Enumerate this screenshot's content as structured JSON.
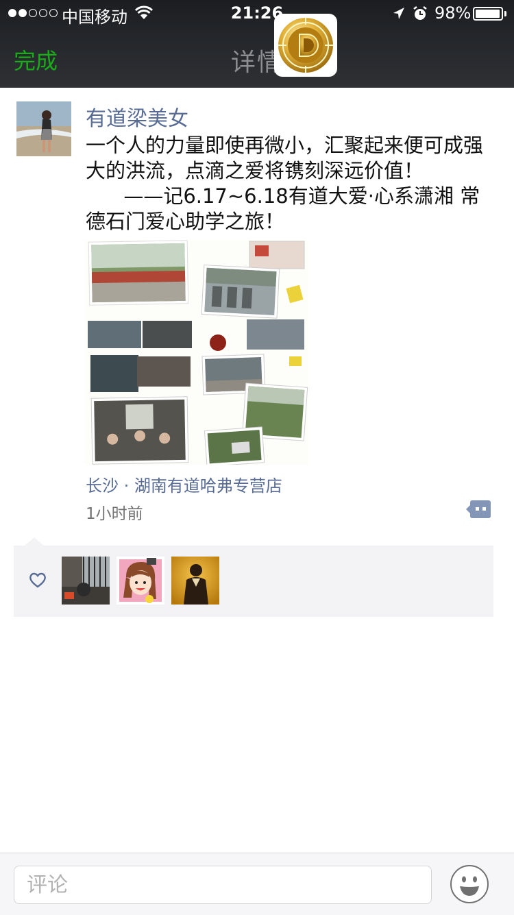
{
  "status_bar": {
    "carrier": "中国移动",
    "time": "21:26",
    "battery": "98%",
    "battery_level": 0.98
  },
  "nav": {
    "done_label": "完成",
    "title": "详情"
  },
  "post": {
    "author": "有道梁美女",
    "text_lines": [
      "一个人的力量即使再微小，汇聚起来便可成强大的洪流，点滴之爱将镌刻深远价值！",
      "      ——记6.17~6.18有道大爱·心系潇湘 常德石门爱心助学之旅！"
    ],
    "location": "长沙 · 湖南有道哈弗专营店",
    "time_ago": "1小时前"
  },
  "likes": {
    "count": 3
  },
  "comment_bar": {
    "placeholder": "评论"
  },
  "colors": {
    "accent_green": "#1aad19",
    "link_blue": "#576b95",
    "header_dark": "#25272b",
    "like_bg": "#f3f3f5"
  },
  "icons": [
    "wifi-icon",
    "location-arrow-icon",
    "alarm-icon",
    "battery-icon",
    "app-logo-icon",
    "comment-more-icon",
    "heart-icon",
    "emoji-icon"
  ]
}
